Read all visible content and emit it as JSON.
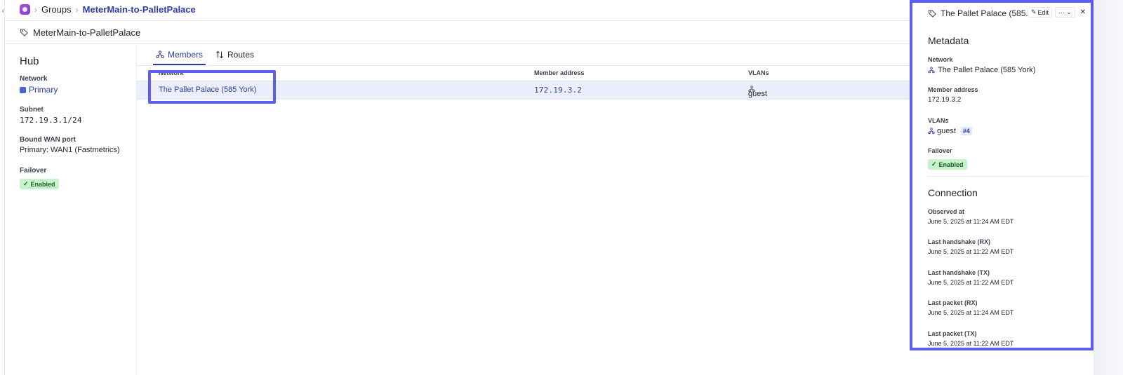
{
  "breadcrumb": {
    "groups": "Groups",
    "current": "MeterMain-to-PalletPalace"
  },
  "page_title": "MeterMain-to-PalletPalace",
  "hub": {
    "heading": "Hub",
    "network_label": "Network",
    "network_value": "Primary",
    "subnet_label": "Subnet",
    "subnet_value": "172.19.3.1/24",
    "wan_label": "Bound WAN port",
    "wan_value": "Primary: WAN1 (Fastmetrics)",
    "failover_label": "Failover",
    "failover_value": "Enabled"
  },
  "tabs": [
    {
      "label": "Members",
      "active": true,
      "icon": "network-icon"
    },
    {
      "label": "Routes",
      "active": false,
      "icon": "routes-icon"
    }
  ],
  "table": {
    "columns": [
      "Network",
      "Member address",
      "VLANs"
    ],
    "rows": [
      {
        "network": "The Pallet Palace (585 York)",
        "address": "172.19.3.2",
        "vlan": "guest"
      }
    ]
  },
  "drawer": {
    "title": "The Pallet Palace (585...",
    "edit_label": "Edit",
    "more_label": "···",
    "metadata_heading": "Metadata",
    "network_label": "Network",
    "network_value": "The Pallet Palace (585 York)",
    "address_label": "Member address",
    "address_value": "172.19.3.2",
    "vlans_label": "VLANs",
    "vlan_name": "guest",
    "vlan_num": "#4",
    "failover_label": "Failover",
    "failover_value": "Enabled",
    "connection_heading": "Connection",
    "observed_label": "Observed at",
    "observed_value": "June 5, 2025 at 11:24 AM EDT",
    "hs_rx_label": "Last handshake (RX)",
    "hs_rx_value": "June 5, 2025 at 11:22 AM EDT",
    "hs_tx_label": "Last handshake (TX)",
    "hs_tx_value": "June 5, 2025 at 11:22 AM EDT",
    "pk_rx_label": "Last packet (RX)",
    "pk_rx_value": "June 5, 2025 at 11:24 AM EDT",
    "pk_tx_label": "Last packet (TX)",
    "pk_tx_value": "June 5, 2025 at 11:22 AM EDT"
  },
  "colors": {
    "accent": "#2a3da8",
    "highlight": "#5b5ef0",
    "success_bg": "#c6f3c9",
    "success_text": "#1e5f2a"
  }
}
